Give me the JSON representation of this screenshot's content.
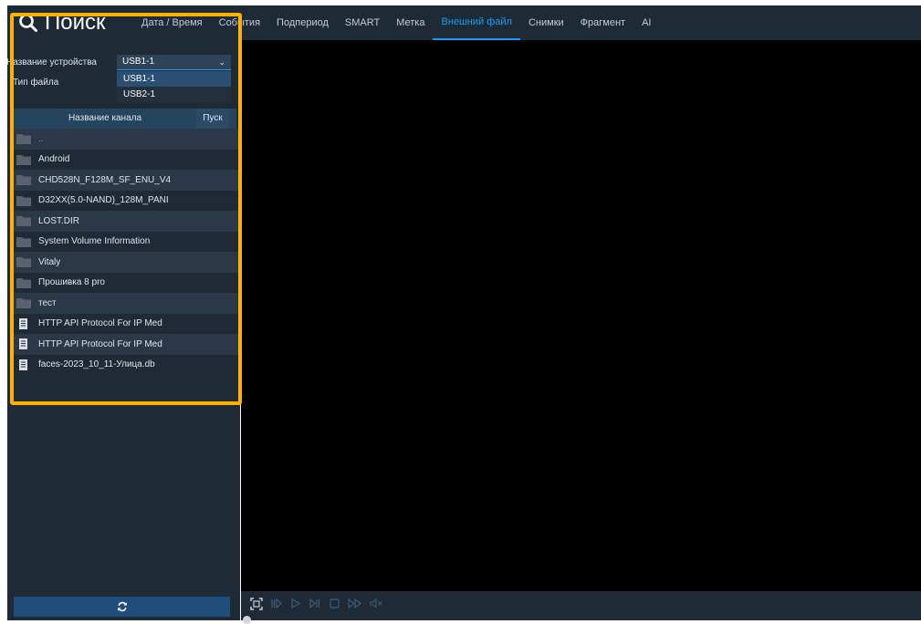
{
  "header": {
    "title": "Поиск",
    "tabs": [
      {
        "label": "Дата / Время",
        "active": false
      },
      {
        "label": "События",
        "active": false
      },
      {
        "label": "Подпериод",
        "active": false
      },
      {
        "label": "SMART",
        "active": false
      },
      {
        "label": "Метка",
        "active": false
      },
      {
        "label": "Внешний файл",
        "active": true
      },
      {
        "label": "Снимки",
        "active": false
      },
      {
        "label": "Фрагмент",
        "active": false
      },
      {
        "label": "AI",
        "active": false
      }
    ]
  },
  "sidebar": {
    "device_label": "Название устройства",
    "device_value": "USB1-1",
    "file_type_label": "Тип файла",
    "device_options": [
      "USB1-1",
      "USB2-1"
    ],
    "table_headers": {
      "name": "Название канала",
      "play": "Пуск"
    },
    "files": [
      {
        "name": "..",
        "type": "folder"
      },
      {
        "name": "Android",
        "type": "folder"
      },
      {
        "name": "CHD528N_F128M_SF_ENU_V4",
        "type": "folder"
      },
      {
        "name": "D32XX(5.0-NAND)_128M_PANI",
        "type": "folder"
      },
      {
        "name": "LOST.DIR",
        "type": "folder"
      },
      {
        "name": "System Volume Information",
        "type": "folder"
      },
      {
        "name": "Vitaly",
        "type": "folder"
      },
      {
        "name": "Прошивка 8 pro",
        "type": "folder"
      },
      {
        "name": "тест",
        "type": "folder"
      },
      {
        "name": "HTTP API Protocol For IP Med",
        "type": "file"
      },
      {
        "name": "HTTP API Protocol For IP Med",
        "type": "file"
      },
      {
        "name": "faces-2023_10_11-Улица.db",
        "type": "file"
      }
    ]
  },
  "colors": {
    "accent": "#1e9cf0",
    "panel": "#1e2a36",
    "highlight": "#ffb000"
  },
  "playback_icons": [
    "fullscreen-icon",
    "step-back-icon",
    "play-icon",
    "step-forward-icon",
    "stop-icon",
    "fast-forward-icon",
    "mute-icon"
  ]
}
